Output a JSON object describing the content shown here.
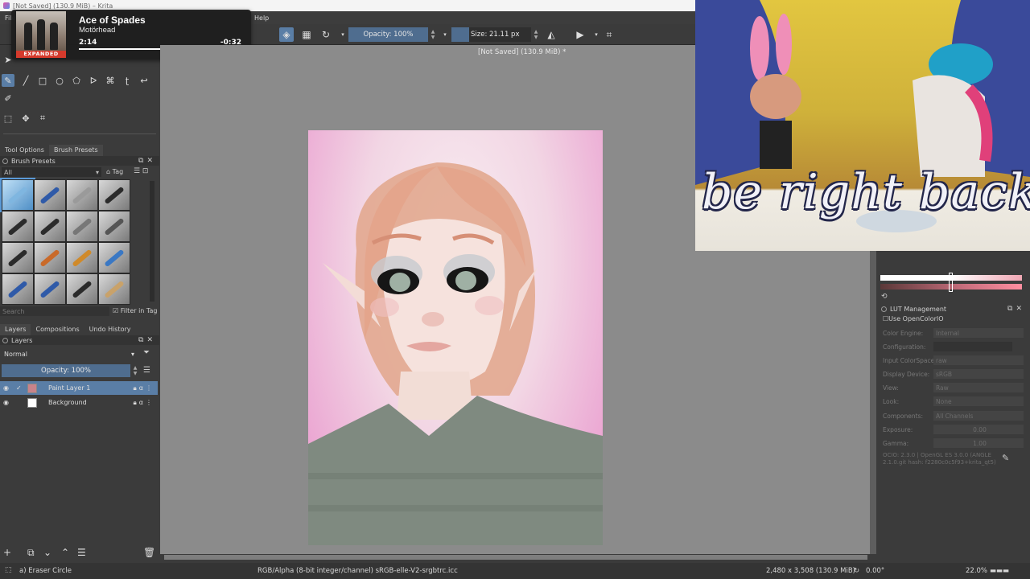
{
  "window": {
    "title": "[Not Saved]  (130.9 MiB)  – Krita",
    "canvas_title": "[Not Saved]  (130.9 MiB) *"
  },
  "menu": {
    "file": "File",
    "help": "Help"
  },
  "toolbar": {
    "opacity": "Opacity: 100%",
    "size": "Size: 21.11 px"
  },
  "media": {
    "song": "Ace of Spades",
    "artist": "Motörhead",
    "elapsed": "2:14",
    "remaining": "-0:32",
    "progress": 0.8,
    "album_label": "EXPANDED"
  },
  "docker_tabs": {
    "tool_options": "Tool Options",
    "brush_presets": "Brush Presets"
  },
  "brush_presets": {
    "title": "Brush Presets",
    "filter_value": "All",
    "tag_label": "Tag",
    "search_placeholder": "Search",
    "filter_in_tag": "Filter in Tag"
  },
  "layer_tabs": {
    "layers": "Layers",
    "compositions": "Compositions",
    "undo_history": "Undo History"
  },
  "layers": {
    "title": "Layers",
    "blend_mode": "Normal",
    "opacity": "Opacity:  100%",
    "items": [
      {
        "name": "Paint Layer 1",
        "active": true
      },
      {
        "name": "Background",
        "active": false
      }
    ]
  },
  "brb": {
    "text": "be right back"
  },
  "lut": {
    "title": "LUT Management",
    "use_ocio": "Use OpenColorIO",
    "rows": [
      {
        "label": "Color Engine:",
        "value": "Internal"
      },
      {
        "label": "Configuration:",
        "value": ""
      },
      {
        "label": "Input ColorSpace:",
        "value": "raw"
      },
      {
        "label": "Display Device:",
        "value": "sRGB"
      },
      {
        "label": "View:",
        "value": "Raw"
      },
      {
        "label": "Look:",
        "value": "None"
      },
      {
        "label": "Components:",
        "value": "All Channels"
      },
      {
        "label": "Exposure:",
        "value": "0.00"
      },
      {
        "label": "Gamma:",
        "value": "1.00"
      }
    ],
    "ocio_info": "OCIO: 2.3.0 | OpenGL ES 3.0.0 (ANGLE 2.1.0.git hash: f2280c0c5f93+krita_qt5)"
  },
  "status": {
    "tool": "a) Eraser Circle",
    "colorspace": "RGB/Alpha (8-bit integer/channel)  sRGB-elle-V2-srgbtrc.icc",
    "dimensions": "2,480 x 3,508 (130.9 MiB)",
    "rotation": "0.00°",
    "zoom": "22.0%"
  },
  "colors": {
    "accent": "#5a7ea6",
    "canvas_bg": "#8b8b8b",
    "panel_bg": "#3b3b3b"
  }
}
